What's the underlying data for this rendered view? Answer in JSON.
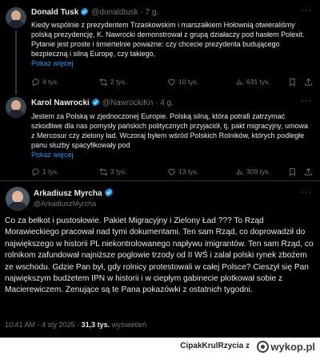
{
  "tweets": [
    {
      "name": "Donald Tusk",
      "handle": "@donaldtusk",
      "time": "· 7 g.",
      "text": "Kiedy wspólnie z prezydentem Trzaskowskim i marszałkiem Hołownią otwieraliśmy polską prezydencję, K. Nawrocki demonstrował z grupą działaczy pod hasłem Polexit. Pytanie jest proste i śmiertelnie poważne: czy chcecie prezydenta budującego bezpieczną i silną Europę, czy takiego,",
      "show_more": "Pokaż więcej",
      "replies": "4 tys.",
      "reposts": "2 tys.",
      "likes": "10 tys.",
      "views": "631 tys."
    },
    {
      "name": "Karol Nawrocki",
      "handle": "@NawrockiKn",
      "time": "· 4 g.",
      "text": "Jestem za Polską w zjednoczonej Europie. Polską silną, która potrafi zatrzymać szkodliwe dla nas pomysły pańskich politycznych przyjaciół, tj. pakt migracyjny, umowa z Mercosur czy zielony ład. Wczoraj byłem wśród Polskich Rolników, których podległe panu służby spacyfikowały pod",
      "show_more": "Pokaż więcej",
      "replies": "1 tys.",
      "reposts": "3 tys.",
      "likes": "13 tys.",
      "views": "309 tys."
    }
  ],
  "main_tweet": {
    "name": "Arkadiusz Myrcha",
    "handle": "@ArkadiuszMyrcha",
    "text": "Co za bełkot i pustosłowie. Pakiet Migracyjny i Zielony Ład ??? To Rząd Morawieckiego pracował nad tymi dokumentami. Ten sam Rząd, co doprowadził do największego w historii PL niekontrolowanego napływu imigrantów. Ten sam Rząd, co rolnikom zafundował najniższe poglowie trzody od II WŚ i zalał polski rynek zbożem ze wschodu. Gdzie Pan był, gdy rolnicy protestowali w całej Polsce? Cieszył się Pan największym budżetem IPN w historii i w ciepłym gabinecie plotkował sobie z Macierewiczem. Żenujące są te Pana pokazówki z ostatnich tygodni.",
    "meta_time": "10:41 AM · 4 sty 2025 ·",
    "meta_views": "31,3 tys.",
    "meta_views_label": "wyświetleń"
  },
  "footer": {
    "credit": "CipakKrulRzycia z",
    "logo": "wykop.pl"
  },
  "colors": {
    "background": "#000000",
    "verified": "#1d9bf0",
    "link": "#1d9bf0",
    "muted": "#71767b"
  }
}
